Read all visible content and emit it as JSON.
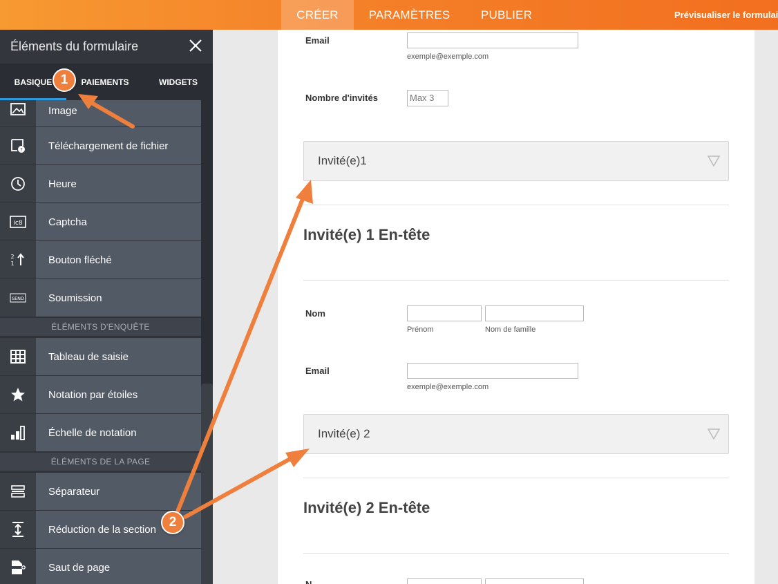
{
  "topbar": {
    "tabs": [
      "CRÉER",
      "PARAMÈTRES",
      "PUBLIER"
    ],
    "active_tab": "CRÉER",
    "preview_label": "Prévisualiser le formulaire"
  },
  "sidebar": {
    "title": "Éléments du formulaire",
    "tabs": [
      "BASIQUE",
      "PAIEMENTS",
      "WIDGETS"
    ],
    "active_tab": "BASIQUE",
    "items": [
      {
        "label": "Image",
        "icon": "image-icon"
      },
      {
        "label": "Téléchargement de fichier",
        "icon": "file-upload-icon"
      },
      {
        "label": "Heure",
        "icon": "clock-icon"
      },
      {
        "label": "Captcha",
        "icon": "captcha-icon"
      },
      {
        "label": "Bouton fléché",
        "icon": "spinner-icon"
      },
      {
        "label": "Soumission",
        "icon": "send-icon"
      },
      {
        "label": "Tableau de saisie",
        "icon": "table-icon"
      },
      {
        "label": "Notation par étoiles",
        "icon": "star-icon"
      },
      {
        "label": "Échelle de notation",
        "icon": "bar-chart-icon"
      },
      {
        "label": "Séparateur",
        "icon": "divider-icon"
      },
      {
        "label": "Réduction de la section",
        "icon": "collapse-icon"
      },
      {
        "label": "Saut de page",
        "icon": "page-break-icon"
      }
    ],
    "sections": [
      "ÉLÉMENTS D'ENQUÊTE",
      "ÉLÉMENTS DE LA PAGE"
    ],
    "send_icon_text": "SEND"
  },
  "form": {
    "email_label": "Email",
    "email_sublabel": "exemple@exemple.com",
    "guests_label": "Nombre d'invités",
    "guests_placeholder": "Max 3",
    "collapse1_label": "Invité(e)1",
    "header1": "Invité(e) 1 En-tête",
    "name_label": "Nom",
    "first_name_sublabel": "Prénom",
    "last_name_sublabel": "Nom de famille",
    "email2_label": "Email",
    "email2_sublabel": "exemple@exemple.com",
    "collapse2_label": "Invité(e) 2",
    "header2": "Invité(e) 2 En-tête",
    "name2_label_partial": "N"
  },
  "annotations": {
    "badge1": "1",
    "badge2": "2",
    "accent": "#ef7f3c"
  }
}
